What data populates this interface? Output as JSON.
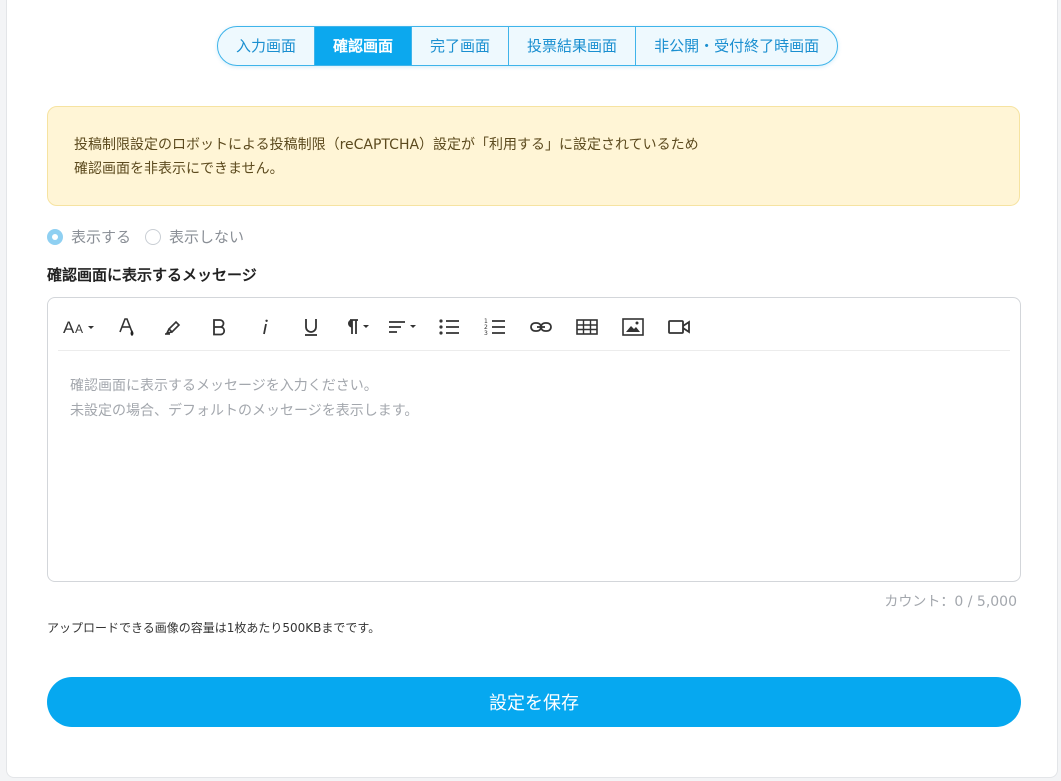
{
  "tabs": [
    {
      "label": "入力画面"
    },
    {
      "label": "確認画面",
      "active": true
    },
    {
      "label": "完了画面"
    },
    {
      "label": "投票結果画面"
    },
    {
      "label": "非公開・受付終了時画面"
    }
  ],
  "alert": {
    "line1": "投稿制限設定のロボットによる投稿制限（reCAPTCHA）設定が「利用する」に設定されているため",
    "line2": "確認画面を非表示にできません。"
  },
  "display_option": {
    "show_label": "表示する",
    "hide_label": "表示しない",
    "selected": "表示する"
  },
  "message_section": {
    "title": "確認画面に表示するメッセージ"
  },
  "editor": {
    "toolbar_icons": [
      "font-size-icon",
      "font-color-icon",
      "highlight-icon",
      "bold-icon",
      "italic-icon",
      "underline-icon",
      "paragraph-icon",
      "align-icon",
      "bullet-list-icon",
      "numbered-list-icon",
      "link-icon",
      "table-icon",
      "image-icon",
      "video-icon"
    ],
    "placeholder_line1": "確認画面に表示するメッセージを入力ください。",
    "placeholder_line2": "未設定の場合、デフォルトのメッセージを表示します。"
  },
  "counter": {
    "text": "カウント：0 / 5,000"
  },
  "upload_note": "アップロードできる画像の容量は1枚あたり500KBまでです。",
  "save_button": {
    "label": "設定を保存"
  },
  "colors": {
    "accent": "#06a8f0",
    "alert_bg": "#fff5d6"
  }
}
